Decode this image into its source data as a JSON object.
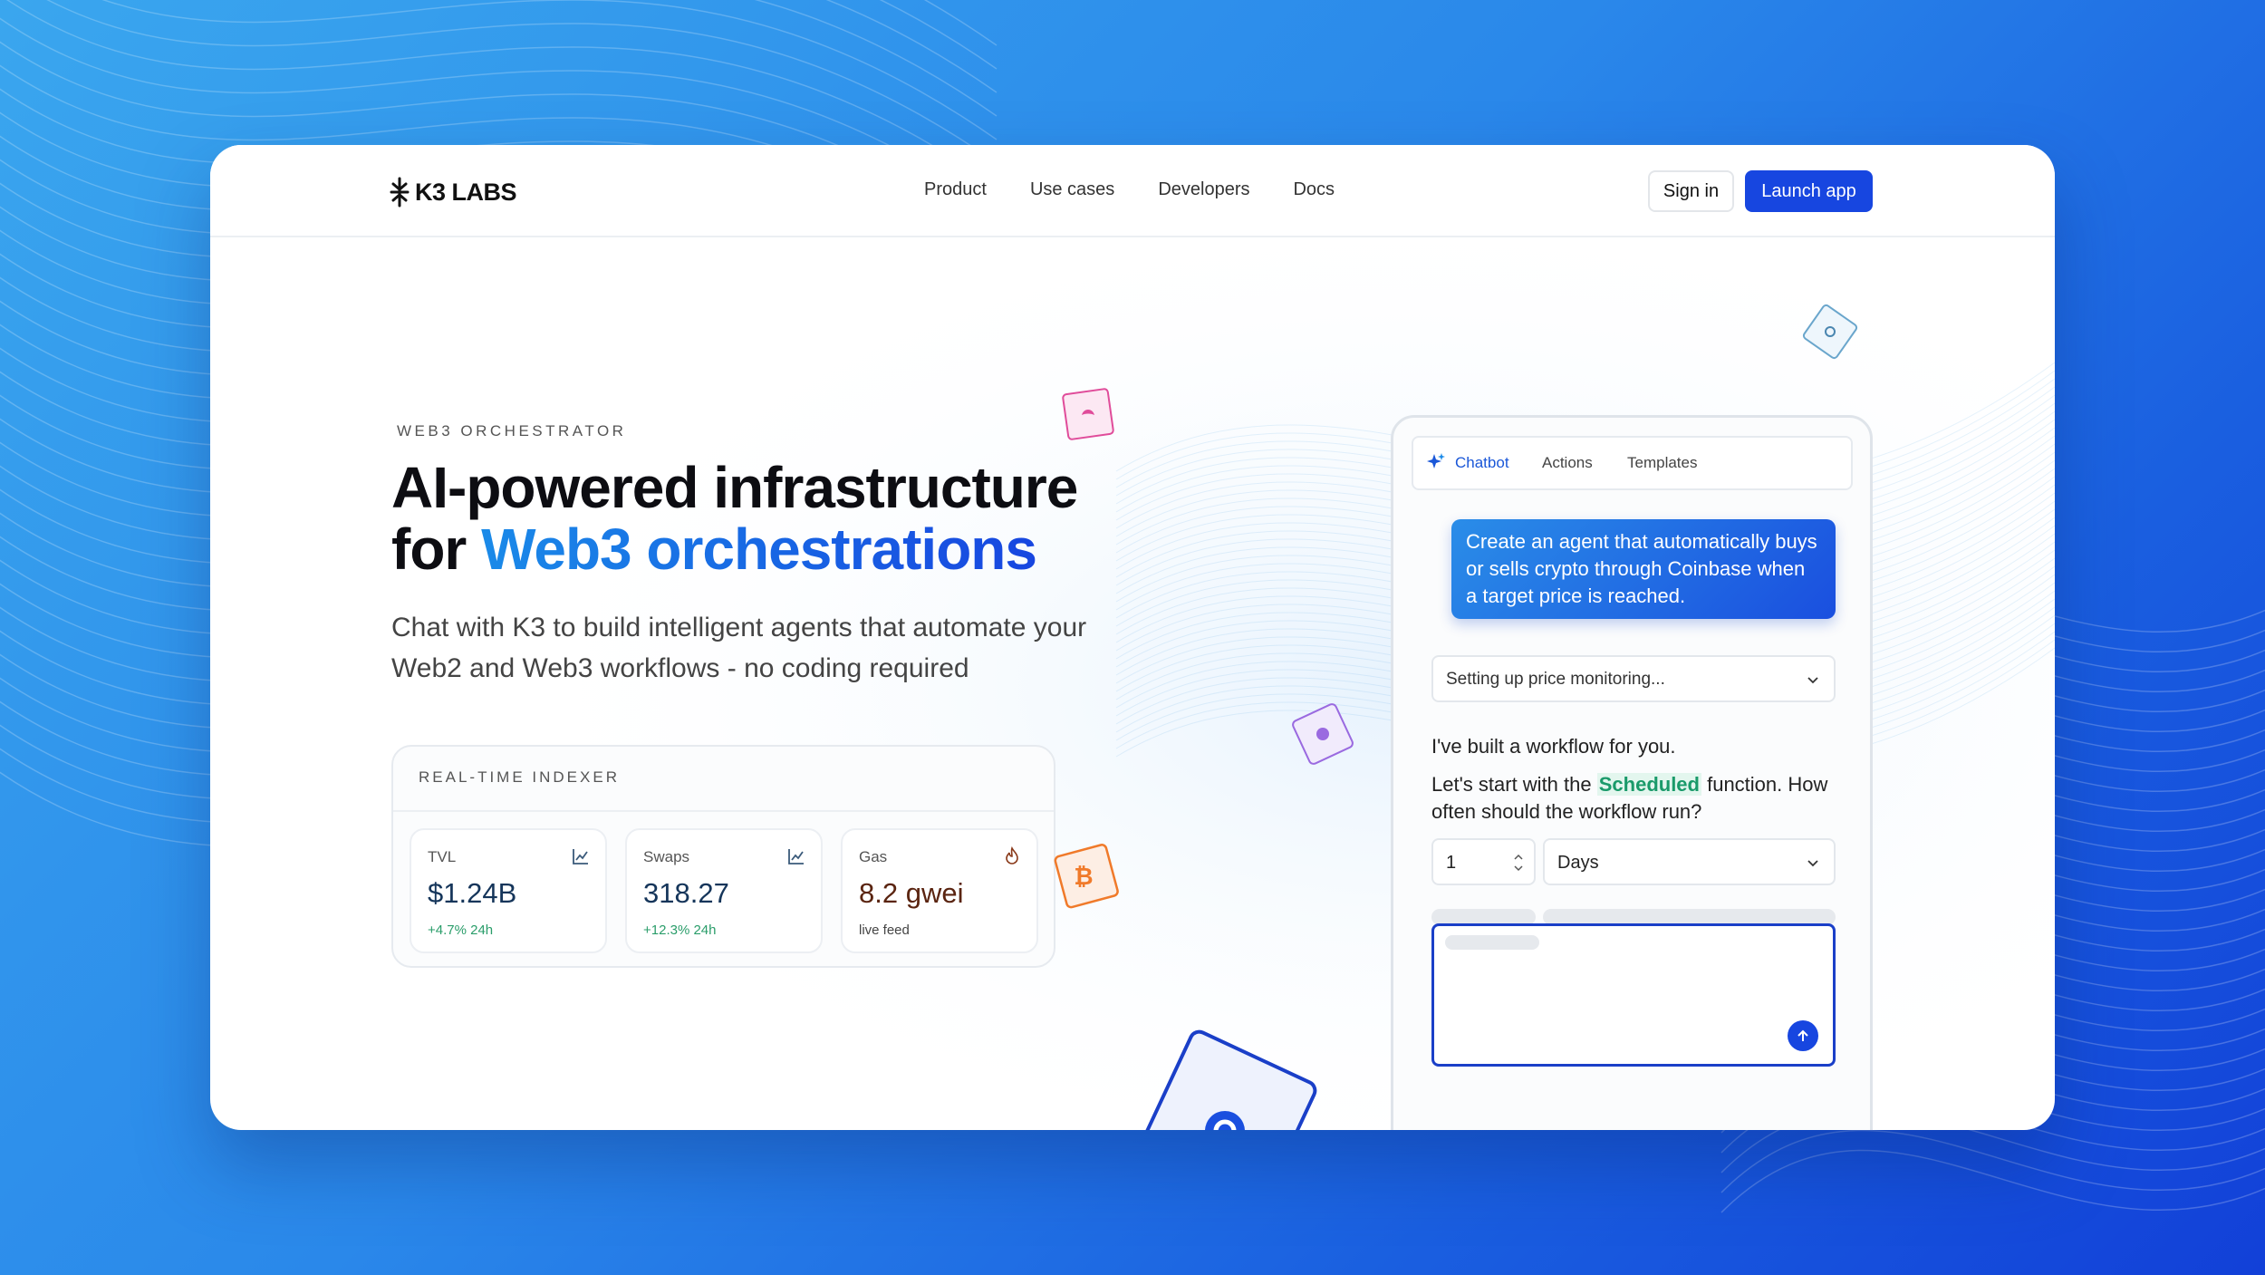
{
  "nav": {
    "logo_text": "K3 LABS",
    "links": [
      "Product",
      "Use cases",
      "Developers",
      "Docs"
    ],
    "signin_label": "Sign in",
    "launch_label": "Launch app"
  },
  "hero": {
    "eyebrow": "WEB3 ORCHESTRATOR",
    "headline_line1": "AI-powered infrastructure",
    "headline_line2_prefix": "for ",
    "headline_line2_accent": "Web3 orchestrations",
    "subhead": "Chat with K3 to build intelligent agents that automate your Web2 and Web3 workflows - no coding required"
  },
  "indexer": {
    "title": "REAL-TIME INDEXER",
    "stats": [
      {
        "label": "TVL",
        "value": "$1.24B",
        "change": "+4.7% 24h",
        "icon": "chart-line-icon"
      },
      {
        "label": "Swaps",
        "value": "318.27",
        "change": "+12.3% 24h",
        "icon": "chart-line-icon"
      },
      {
        "label": "Gas",
        "value": "8.2 gwei",
        "change": "live feed",
        "icon": "flame-icon"
      }
    ]
  },
  "chat": {
    "tabs": [
      "Chatbot",
      "Actions",
      "Templates"
    ],
    "user_message": "Create an agent that automatically buys or sells crypto through Coinbase when a target price is reached.",
    "status": "Setting up price monitoring...",
    "bot_line1": "I've built a workflow for you.",
    "bot_line2_prefix": "Let's start with the ",
    "bot_line2_highlight": "Scheduled",
    "bot_line2_suffix": " function. How often should the workflow run?",
    "interval_value": "1",
    "interval_unit": "Days"
  },
  "colors": {
    "accent": "#1746e0",
    "accent_light": "#1a8ae8",
    "positive": "#2a9d6a",
    "bitcoin": "#f07a2a",
    "pink_token": "#e04c9a",
    "purple_token": "#9a6ae0"
  }
}
